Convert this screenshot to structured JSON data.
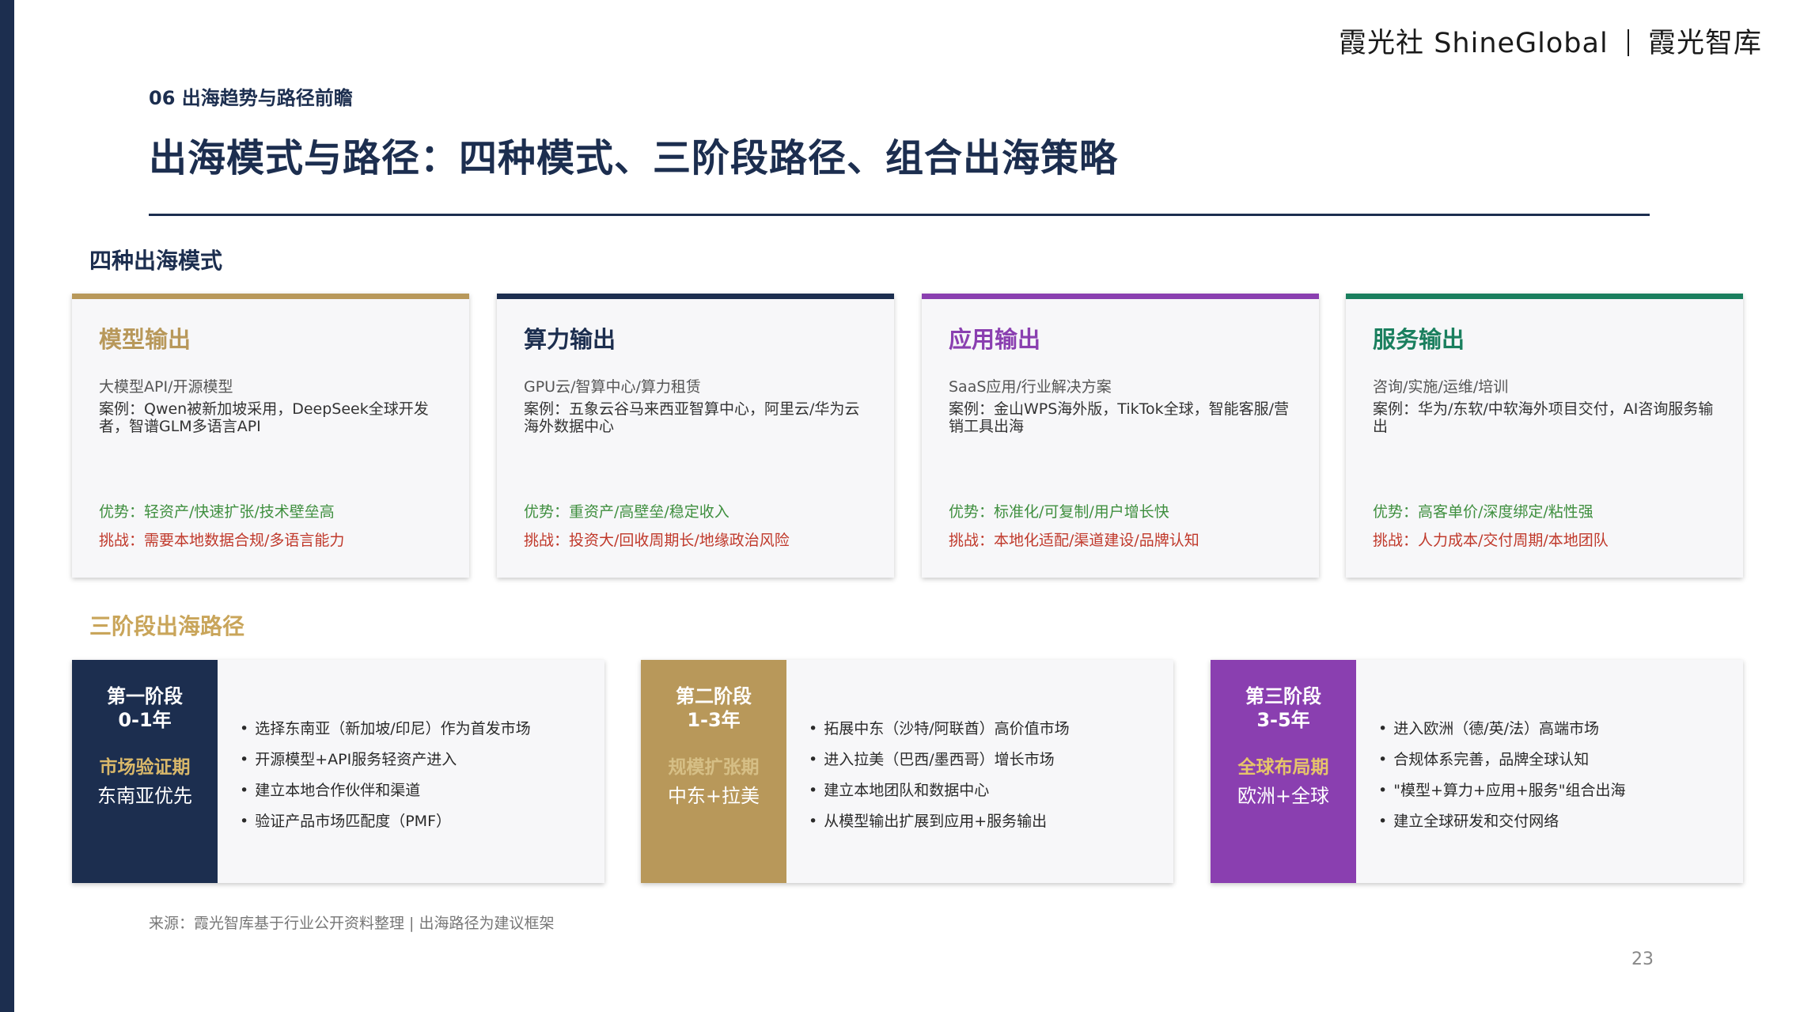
{
  "brand": {
    "left": "霞光社",
    "middle": "ShineGlobal",
    "right": "霞光智库"
  },
  "section_label": "06 出海趋势与路径前瞻",
  "title": "出海模式与路径：四种模式、三阶段路径、组合出海策略",
  "modes_heading": "四种出海模式",
  "modes": [
    {
      "title": "模型输出",
      "subtitle": "大模型API/开源模型",
      "case": "案例：Qwen被新加坡采用，DeepSeek全球开发者，智谱GLM多语言API",
      "advantage": "优势：轻资产/快速扩张/技术壁垒高",
      "challenge": "挑战：需要本地数据合规/多语言能力",
      "accent": "#b8985a",
      "title_color": "#b8985a"
    },
    {
      "title": "算力输出",
      "subtitle": "GPU云/智算中心/算力租赁",
      "case": "案例：五象云谷马来西亚智算中心，阿里云/华为云海外数据中心",
      "advantage": "优势：重资产/高壁垒/稳定收入",
      "challenge": "挑战：投资大/回收周期长/地缘政治风险",
      "accent": "#1c2e4f",
      "title_color": "#1c2e4f"
    },
    {
      "title": "应用输出",
      "subtitle": "SaaS应用/行业解决方案",
      "case": "案例：金山WPS海外版，TikTok全球，智能客服/营销工具出海",
      "advantage": "优势：标准化/可复制/用户增长快",
      "challenge": "挑战：本地化适配/渠道建设/品牌认知",
      "accent": "#8a3fb0",
      "title_color": "#8a3fb0"
    },
    {
      "title": "服务输出",
      "subtitle": "咨询/实施/运维/培训",
      "case": "案例：华为/东软/中软海外项目交付，AI咨询服务输出",
      "advantage": "优势：高客单价/深度绑定/粘性强",
      "challenge": "挑战：人力成本/交付周期/本地团队",
      "accent": "#1a7f5e",
      "title_color": "#1a7f5e"
    }
  ],
  "stages_heading": "三阶段出海路径",
  "stages": [
    {
      "name": "第一阶段",
      "years": "0-1年",
      "phase": "市场验证期",
      "region": "东南亚优先",
      "bg": "#1c2e4f",
      "phase_color": "#d9b86a",
      "items": [
        "选择东南亚（新加坡/印尼）作为首发市场",
        "开源模型+API服务轻资产进入",
        "建立本地合作伙伴和渠道",
        "验证产品市场匹配度（PMF）"
      ]
    },
    {
      "name": "第二阶段",
      "years": "1-3年",
      "phase": "规模扩张期",
      "region": "中东+拉美",
      "bg": "#b8985a",
      "phase_color": "#d6bf86",
      "items": [
        "拓展中东（沙特/阿联酋）高价值市场",
        "进入拉美（巴西/墨西哥）增长市场",
        "建立本地团队和数据中心",
        "从模型输出扩展到应用+服务输出"
      ]
    },
    {
      "name": "第三阶段",
      "years": "3-5年",
      "phase": "全球布局期",
      "region": "欧洲+全球",
      "bg": "#8a3fb0",
      "phase_color": "#e6c46a",
      "items": [
        "进入欧洲（德/英/法）高端市场",
        "合规体系完善，品牌全球认知",
        "\"模型+算力+应用+服务\"组合出海",
        "建立全球研发和交付网络"
      ]
    }
  ],
  "source": "来源：霞光智库基于行业公开资料整理 | 出海路径为建议框架",
  "page_number": "23"
}
